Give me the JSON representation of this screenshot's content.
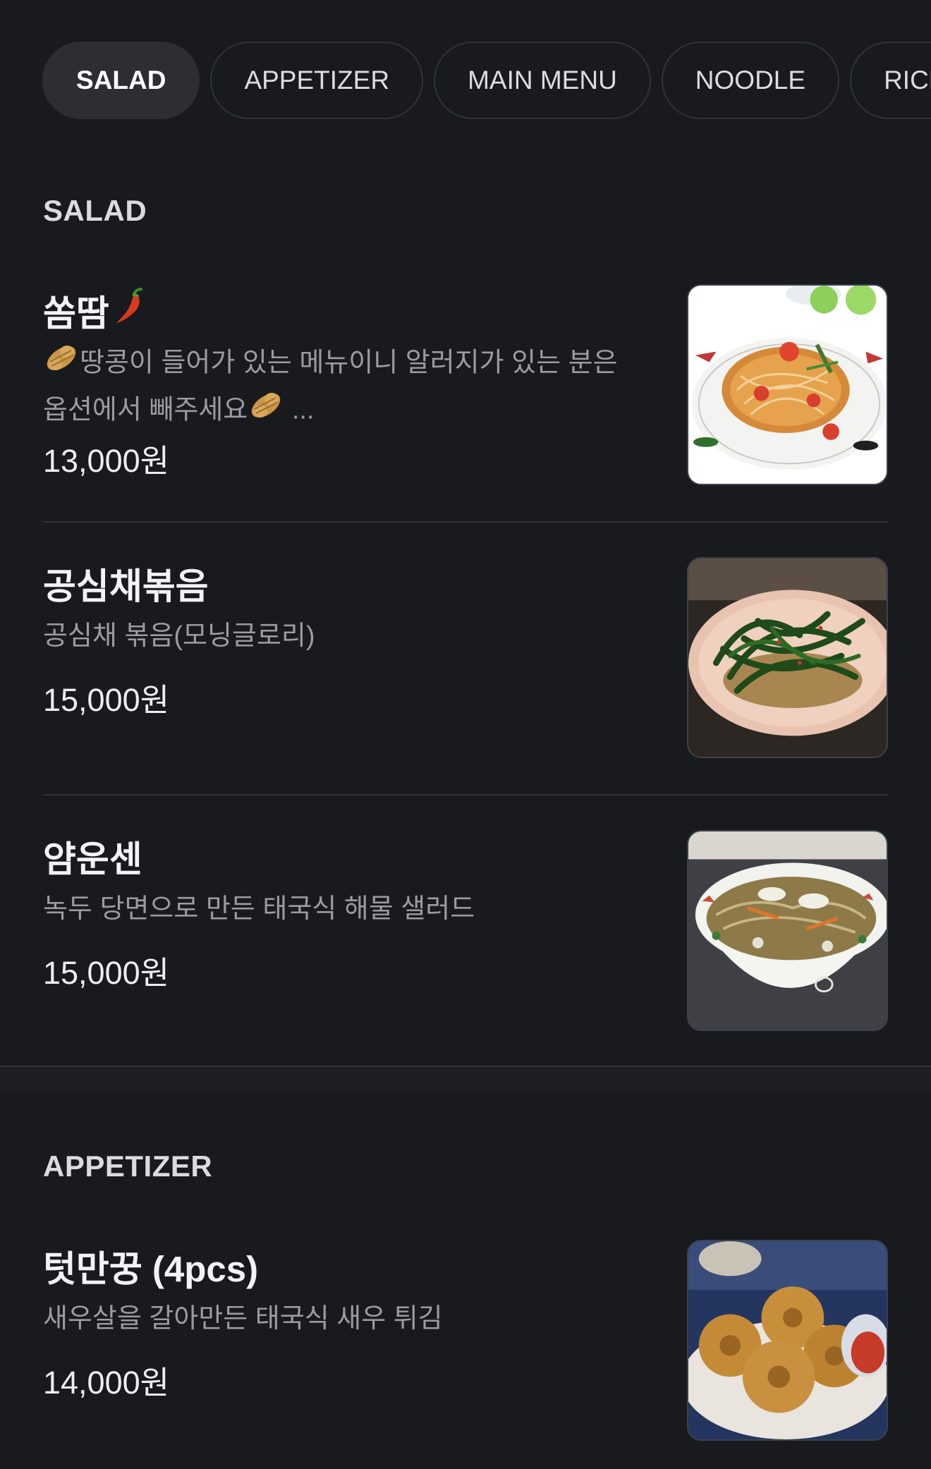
{
  "tabs": [
    "SALAD",
    "APPETIZER",
    "MAIN MENU",
    "NOODLE",
    "RICE"
  ],
  "active_tab": "SALAD",
  "sections": [
    {
      "title": "SALAD",
      "items": [
        {
          "name": "쏨땀",
          "name_icon": "chili-pepper-icon",
          "desc_icon": "peanut-icon",
          "desc_line1": "땅콩이 들어가 있는 메뉴이니 알러지가 있는 분은",
          "desc_line2": "옵션에서 빼주세요",
          "desc_ellipsis": "...",
          "price": "13,000원",
          "image": "papaya-salad-photo"
        },
        {
          "name": "공심채볶음",
          "desc": "공심채 볶음(모닝글로리)",
          "price": "15,000원",
          "image": "morning-glory-photo"
        },
        {
          "name": "얌운센",
          "desc": "녹두 당면으로 만든 태국식 해물 샐러드",
          "price": "15,000원",
          "image": "glass-noodle-salad-photo"
        }
      ]
    },
    {
      "title": "APPETIZER",
      "items": [
        {
          "name": "텃만꿍 (4pcs)",
          "desc": "새우살을 갈아만든 태국식 새우 튀김",
          "price": "14,000원",
          "image": "shrimp-cake-photo"
        }
      ]
    }
  ]
}
